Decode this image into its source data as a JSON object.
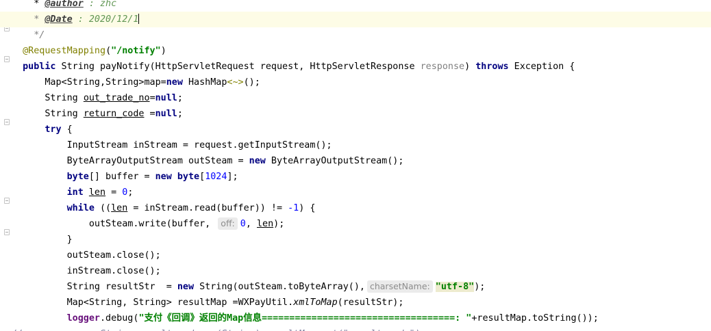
{
  "editor": {
    "lines": [
      [
        {
          "t": "    * "
        },
        {
          "t": "@author",
          "c": "dtag"
        },
        {
          "t": " : zhc",
          "c": "dval"
        }
      ],
      [
        {
          "t": "    * ",
          "c": "cmt"
        },
        {
          "t": "@Date",
          "c": "dtag"
        },
        {
          "t": " : 2020/12/1",
          "c": "dval"
        }
      ],
      [
        {
          "t": "    */",
          "c": "cmt"
        }
      ],
      [
        {
          "t": "  "
        },
        {
          "t": "@RequestMapping",
          "c": "ann"
        },
        {
          "t": "("
        },
        {
          "t": "\"/notify\"",
          "c": "str"
        },
        {
          "t": ")"
        }
      ],
      [
        {
          "t": "  "
        },
        {
          "t": "public",
          "c": "kw"
        },
        {
          "t": " String payNotify(HttpServletRequest request, HttpServletResponse "
        },
        {
          "t": "response",
          "c": "gray"
        },
        {
          "t": ") "
        },
        {
          "t": "throws",
          "c": "kw"
        },
        {
          "t": " Exception {"
        }
      ],
      [
        {
          "t": "      Map<String,String>map="
        },
        {
          "t": "new",
          "c": "kw"
        },
        {
          "t": " HashMap"
        },
        {
          "t": "<~>",
          "c": "ann"
        },
        {
          "t": "();"
        }
      ],
      [
        {
          "t": "      String "
        },
        {
          "t": "out_trade_no",
          "c": "ul"
        },
        {
          "t": "="
        },
        {
          "t": "null",
          "c": "kw"
        },
        {
          "t": ";"
        }
      ],
      [
        {
          "t": "      String "
        },
        {
          "t": "return_code",
          "c": "ul"
        },
        {
          "t": " ="
        },
        {
          "t": "null",
          "c": "kw"
        },
        {
          "t": ";"
        }
      ],
      [
        {
          "t": "      "
        },
        {
          "t": "try",
          "c": "kw"
        },
        {
          "t": " {"
        }
      ],
      [
        {
          "t": "          InputStream inStream = request.getInputStream();"
        }
      ],
      [
        {
          "t": "          ByteArrayOutputStream outSteam = "
        },
        {
          "t": "new",
          "c": "kw"
        },
        {
          "t": " ByteArrayOutputStream();"
        }
      ],
      [
        {
          "t": "          "
        },
        {
          "t": "byte",
          "c": "kw"
        },
        {
          "t": "[] buffer = "
        },
        {
          "t": "new",
          "c": "kw"
        },
        {
          "t": " "
        },
        {
          "t": "byte",
          "c": "kw"
        },
        {
          "t": "["
        },
        {
          "t": "1024",
          "c": "num"
        },
        {
          "t": "];"
        }
      ],
      [
        {
          "t": "          "
        },
        {
          "t": "int",
          "c": "kw"
        },
        {
          "t": " "
        },
        {
          "t": "len",
          "c": "ul"
        },
        {
          "t": " = "
        },
        {
          "t": "0",
          "c": "num"
        },
        {
          "t": ";"
        }
      ],
      [
        {
          "t": "          "
        },
        {
          "t": "while",
          "c": "kw"
        },
        {
          "t": " (("
        },
        {
          "t": "len",
          "c": "ul"
        },
        {
          "t": " = inStream.read(buffer)) != "
        },
        {
          "t": "-1",
          "c": "num"
        },
        {
          "t": ") {"
        }
      ],
      [
        {
          "t": "              outSteam.write(buffer, "
        },
        {
          "t": "off:",
          "c": "hint"
        },
        {
          "t": "0",
          "c": "num"
        },
        {
          "t": ", "
        },
        {
          "t": "len",
          "c": "ul"
        },
        {
          "t": ");"
        }
      ],
      [
        {
          "t": "          }"
        }
      ],
      [
        {
          "t": "          outSteam.close();"
        }
      ],
      [
        {
          "t": "          inStream.close();"
        }
      ],
      [
        {
          "t": "          String resultStr  = "
        },
        {
          "t": "new",
          "c": "kw"
        },
        {
          "t": " String(outSteam.toByteArray(),"
        },
        {
          "t": "charsetName:",
          "c": "hint"
        },
        {
          "t": "\"utf-8\"",
          "c": "str strhl"
        },
        {
          "t": ");"
        }
      ],
      [
        {
          "t": "          Map<String, String> resultMap =WXPayUtil."
        },
        {
          "t": "xmlToMap",
          "c": "it"
        },
        {
          "t": "(resultStr);"
        }
      ],
      [
        {
          "t": "          "
        },
        {
          "t": "logger",
          "c": "fld"
        },
        {
          "t": ".debug("
        },
        {
          "t": "\"支付《回调》返回的Map信息===================================: \"",
          "c": "str"
        },
        {
          "t": "+resultMap.toString());"
        }
      ],
      [
        {
          "t": "//",
          "c": "cmtline"
        },
        {
          "t": "              String result_code = (String) resultMap.get(\"result_code\");",
          "c": "cmtline"
        }
      ]
    ]
  }
}
